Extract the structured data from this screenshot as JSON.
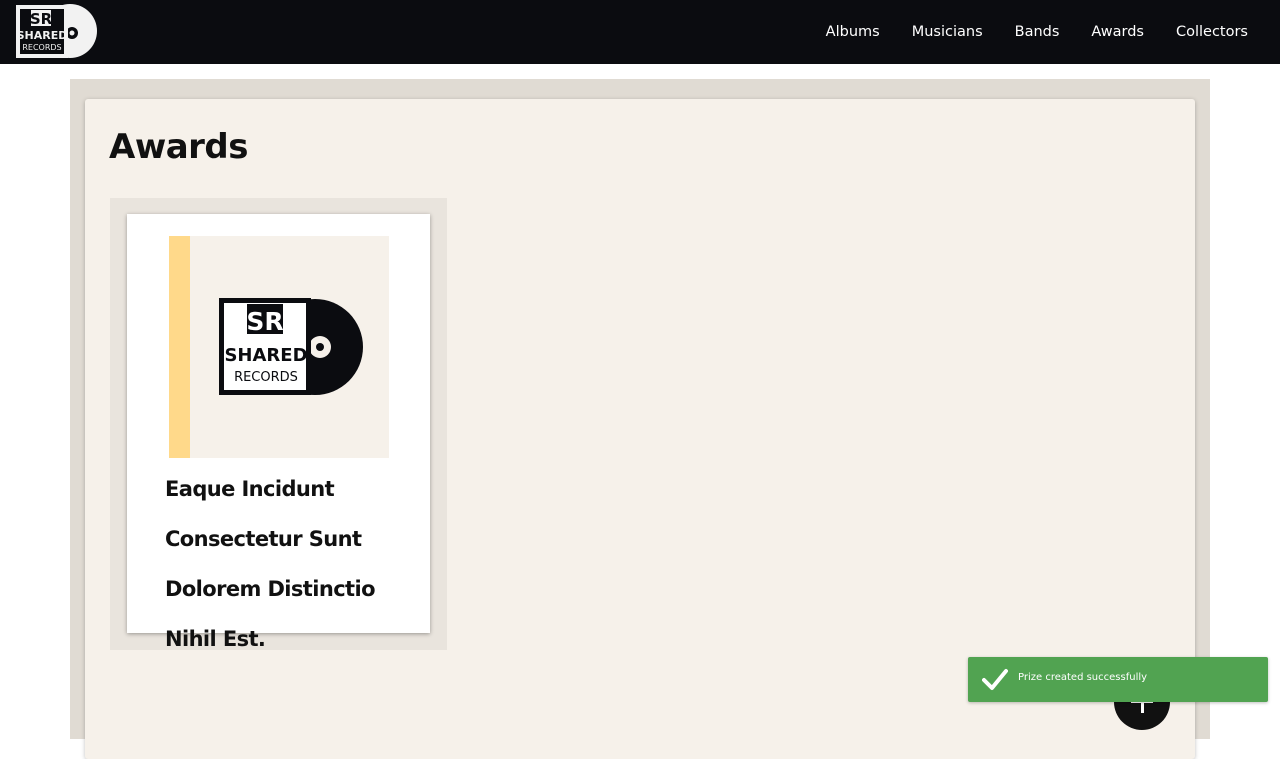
{
  "navbar": {
    "logo": {
      "line1": "SR",
      "line2": "SHARED",
      "line3": "RECORDS",
      "icon": "shared-records-logo"
    },
    "links": [
      {
        "label": "Albums"
      },
      {
        "label": "Musicians"
      },
      {
        "label": "Bands"
      },
      {
        "label": "Awards"
      },
      {
        "label": "Collectors"
      }
    ]
  },
  "main": {
    "title": "Awards",
    "awards": [
      {
        "name": "Eaque Incidunt Consectetur Sunt Dolorem Distinctio Nihil Est.",
        "image": {
          "line1": "SR",
          "line2": "SHARED",
          "line3": "RECORDS",
          "icon": "shared-records-logo"
        }
      }
    ]
  },
  "fab": {
    "icon": "plus-icon"
  },
  "toast": {
    "message": "Prize created successfully",
    "icon": "check-icon"
  },
  "colors": {
    "navbar": "#0b0c10",
    "page_background": "#e0dbd3",
    "card_background": "#f6f1ea",
    "accent_stripe": "#ffd98a",
    "toast": "#51a351"
  }
}
